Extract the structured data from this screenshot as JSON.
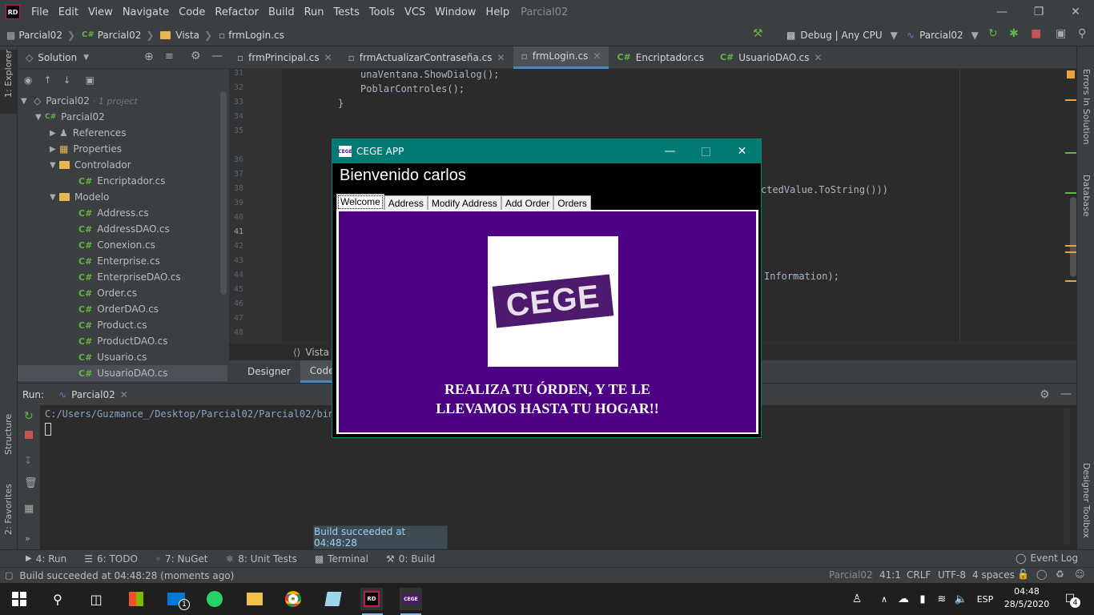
{
  "menubar": {
    "logo": "RD",
    "items": [
      "File",
      "Edit",
      "View",
      "Navigate",
      "Code",
      "Refactor",
      "Build",
      "Run",
      "Tests",
      "Tools",
      "VCS",
      "Window",
      "Help"
    ],
    "project": "Parcial02"
  },
  "navbar": {
    "breadcrumbs": [
      "Parcial02",
      "Parcial02",
      "Vista",
      "frmLogin.cs"
    ],
    "config": "Debug | Any CPU",
    "run_target": "Parcial02"
  },
  "left_strip": {
    "explorer": "1: Explorer",
    "structure": "Structure",
    "favorites": "2: Favorites"
  },
  "right_strip": {
    "errors": "Errors In Solution",
    "database": "Database",
    "toolbox": "Designer Toolbox"
  },
  "solution": {
    "header": "Solution",
    "root": "Parcial02",
    "root_note": "· 1 project",
    "items": [
      {
        "label": "Parcial02",
        "type": "project"
      },
      {
        "label": "References",
        "type": "refs"
      },
      {
        "label": "Properties",
        "type": "props"
      },
      {
        "label": "Controlador",
        "type": "folder"
      },
      {
        "label": "Encriptador.cs",
        "type": "cs"
      },
      {
        "label": "Modelo",
        "type": "folder"
      },
      {
        "label": "Address.cs",
        "type": "cs"
      },
      {
        "label": "AddressDAO.cs",
        "type": "cs"
      },
      {
        "label": "Conexion.cs",
        "type": "cs"
      },
      {
        "label": "Enterprise.cs",
        "type": "cs"
      },
      {
        "label": "EnterpriseDAO.cs",
        "type": "cs"
      },
      {
        "label": "Order.cs",
        "type": "cs"
      },
      {
        "label": "OrderDAO.cs",
        "type": "cs"
      },
      {
        "label": "Product.cs",
        "type": "cs"
      },
      {
        "label": "ProductDAO.cs",
        "type": "cs"
      },
      {
        "label": "Usuario.cs",
        "type": "cs"
      },
      {
        "label": "UsuarioDAO.cs",
        "type": "cs"
      }
    ]
  },
  "editor": {
    "tabs": [
      {
        "label": "frmPrincipal.cs"
      },
      {
        "label": "frmActualizarContraseña.cs"
      },
      {
        "label": "frmLogin.cs"
      },
      {
        "label": "Encriptador.cs"
      },
      {
        "label": "UsuarioDAO.cs"
      }
    ],
    "line_numbers": [
      "31",
      "32",
      "33",
      "34",
      "35",
      "36",
      "37",
      "38",
      "39",
      "40",
      "41",
      "42",
      "43",
      "44",
      "45",
      "46",
      "47",
      "48"
    ],
    "code": {
      "l31": "unaVentana.ShowDialog();",
      "l32": "PoblarControles();",
      "l33": "}",
      "l38": "ctedValue.ToString()))",
      "l44": "Information);"
    },
    "footer": "Vista",
    "design_tabs": [
      "Designer",
      "Code"
    ]
  },
  "run": {
    "label": "Run:",
    "config": "Parcial02",
    "output": "C:/Users/Guzmance_/Desktop/Parcial02/Parcial02/bin/D"
  },
  "toast": "Build succeeded at 04:48:28",
  "bottom_tabs": [
    "4: Run",
    "6: TODO",
    "7: NuGet",
    "8: Unit Tests",
    "Terminal",
    "0: Build"
  ],
  "event_log": "Event Log",
  "status": {
    "message": "Build succeeded at 04:48:28 (moments ago)",
    "project": "Parcial02",
    "position": "41:1",
    "line_ending": "CRLF",
    "encoding": "UTF-8",
    "indent": "4 spaces"
  },
  "app": {
    "title": "CEGE APP",
    "icon_text": "CEGE",
    "welcome": "Bienvenido carlos",
    "tabs": [
      "Welcome",
      "Address",
      "Modify Address",
      "Add Order",
      "Orders"
    ],
    "logo_text": "CEGE",
    "slogan_line1": "REALIZA TU ÓRDEN, Y TE LE",
    "slogan_line2": "LLEVAMOS HASTA TU HOGAR!!"
  },
  "taskbar": {
    "lang": "ESP",
    "time": "04:48",
    "date": "28/5/2020",
    "notifications": "4",
    "mail_badge": "1"
  }
}
